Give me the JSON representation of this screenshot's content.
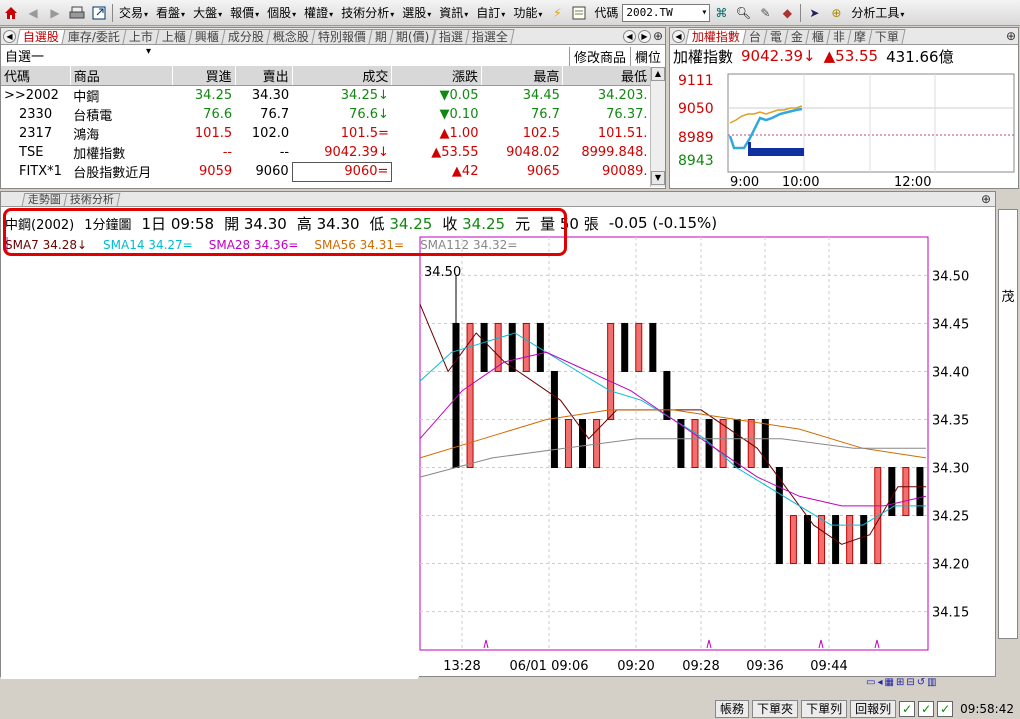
{
  "menubar": {
    "items": [
      "交易",
      "看盤",
      "大盤",
      "報價",
      "個股",
      "權證",
      "技術分析",
      "選股",
      "資訊",
      "自訂",
      "功能"
    ],
    "code_label": "代碼",
    "code_value": "2002.TW",
    "analysis_tools": "分析工具"
  },
  "watchlist": {
    "tabs": [
      "自選股",
      "庫存/委託",
      "上市",
      "上櫃",
      "興櫃",
      "成分股",
      "概念股",
      "特別報價",
      "期",
      "期(價)",
      "指選",
      "指選全"
    ],
    "list_name": "自選一",
    "edit_label": "修改商品",
    "field_label": "欄位",
    "headers": [
      "代碼",
      "商品",
      "買進",
      "賣出",
      "成交",
      "漲跌",
      "最高",
      "最低"
    ],
    "rows": [
      {
        "code": ">>2002",
        "name": "中鋼",
        "bid": "34.25",
        "ask": "34.30",
        "last": "34.25↓",
        "chg": "▼0.05",
        "high": "34.45",
        "low": "34.20",
        "extra": "3.",
        "color": "#118811",
        "chgcolor": "#118811"
      },
      {
        "code": "2330",
        "name": "台積電",
        "bid": "76.6",
        "ask": "76.7",
        "last": "76.6↓",
        "chg": "▼0.10",
        "high": "76.7",
        "low": "76.3",
        "extra": "7.",
        "color": "#118811",
        "chgcolor": "#118811"
      },
      {
        "code": "2317",
        "name": "鴻海",
        "bid": "101.5",
        "ask": "102.0",
        "last": "101.5=",
        "chg": "▲1.00",
        "high": "102.5",
        "low": "101.5",
        "extra": "1.",
        "color": "#d00000",
        "chgcolor": "#d00000"
      },
      {
        "code": "TSE",
        "name": "加權指數",
        "bid": "--",
        "ask": "--",
        "last": "9042.39↓",
        "chg": "▲53.55",
        "high": "9048.02",
        "low": "8999.84",
        "extra": "8.",
        "color": "#d00000",
        "chgcolor": "#d00000"
      },
      {
        "code": "FITX*1",
        "name": "台股指數近月",
        "bid": "9059",
        "ask": "9060",
        "last": "9060=",
        "chg": "▲42",
        "high": "9065",
        "low": "9008",
        "extra": "9.",
        "color": "#d00000",
        "chgcolor": "#d00000"
      }
    ]
  },
  "index_panel": {
    "tabs": [
      "加權指數",
      "台",
      "電",
      "金",
      "櫃",
      "非",
      "摩",
      "下單"
    ],
    "title": "加權指數",
    "value": "9042.39↓",
    "change": "▲53.55",
    "volume": "431.66億",
    "yticks": [
      "9111",
      "9050",
      "8989",
      "8943"
    ],
    "xticks": [
      "9:00",
      "10:00",
      "12:00"
    ]
  },
  "chart": {
    "tabs": [
      "走勢圖",
      "技術分析"
    ],
    "info": {
      "name": "中鋼(2002)",
      "period": "1分鐘圖",
      "date": "1日 09:58",
      "open_label": "開",
      "open": "34.30",
      "high_label": "高",
      "high": "34.30",
      "low_label": "低",
      "low": "34.25",
      "close_label": "收",
      "close": "34.25",
      "unit": "元",
      "vol_label": "量",
      "vol": "50",
      "vol_unit": "張",
      "change": "-0.05 (-0.15%)"
    },
    "sma": [
      "SMA7 34.28↓",
      "SMA14 34.27=",
      "SMA28 34.36=",
      "SMA56 34.31=",
      "SMA112 34.32="
    ],
    "peak_label": "34.50",
    "yticks": [
      "34.50",
      "34.45",
      "34.40",
      "34.35",
      "34.30",
      "34.25",
      "34.20",
      "34.15"
    ],
    "xticks": [
      "13:28",
      "06/01 09:06",
      "09:20",
      "09:28",
      "09:36",
      "09:44"
    ],
    "side_label": "茂"
  },
  "chart_data": {
    "type": "candlestick",
    "title": "",
    "ylim": [
      34.11,
      34.54
    ],
    "bar_values": [
      [
        34.45,
        34.5,
        34.3,
        34.3
      ],
      [
        34.3,
        34.45,
        34.3,
        34.45
      ],
      [
        34.45,
        34.45,
        34.4,
        34.4
      ],
      [
        34.4,
        34.45,
        34.4,
        34.45
      ],
      [
        34.45,
        34.45,
        34.4,
        34.4
      ],
      [
        34.4,
        34.45,
        34.4,
        34.45
      ],
      [
        34.45,
        34.45,
        34.4,
        34.4
      ],
      [
        34.4,
        34.4,
        34.3,
        34.3
      ],
      [
        34.3,
        34.35,
        34.3,
        34.35
      ],
      [
        34.35,
        34.35,
        34.3,
        34.3
      ],
      [
        34.3,
        34.35,
        34.3,
        34.35
      ],
      [
        34.35,
        34.45,
        34.35,
        34.45
      ],
      [
        34.45,
        34.45,
        34.4,
        34.4
      ],
      [
        34.4,
        34.45,
        34.4,
        34.45
      ],
      [
        34.45,
        34.45,
        34.4,
        34.4
      ],
      [
        34.4,
        34.4,
        34.35,
        34.35
      ],
      [
        34.35,
        34.35,
        34.3,
        34.3
      ],
      [
        34.3,
        34.35,
        34.3,
        34.35
      ],
      [
        34.35,
        34.35,
        34.3,
        34.3
      ],
      [
        34.3,
        34.35,
        34.3,
        34.35
      ],
      [
        34.35,
        34.35,
        34.3,
        34.3
      ],
      [
        34.3,
        34.35,
        34.3,
        34.35
      ],
      [
        34.35,
        34.35,
        34.3,
        34.3
      ],
      [
        34.3,
        34.3,
        34.2,
        34.2
      ],
      [
        34.2,
        34.25,
        34.2,
        34.25
      ],
      [
        34.25,
        34.25,
        34.2,
        34.2
      ],
      [
        34.2,
        34.25,
        34.2,
        34.25
      ],
      [
        34.25,
        34.25,
        34.2,
        34.2
      ],
      [
        34.2,
        34.25,
        34.2,
        34.25
      ],
      [
        34.25,
        34.25,
        34.2,
        34.2
      ],
      [
        34.2,
        34.3,
        34.2,
        34.3
      ],
      [
        34.3,
        34.3,
        34.25,
        34.25
      ],
      [
        34.25,
        34.3,
        34.25,
        34.3
      ],
      [
        34.3,
        34.3,
        34.25,
        34.25
      ]
    ],
    "sma_series": [
      {
        "name": "SMA7",
        "values": [
          34.47,
          34.4,
          34.44,
          34.41,
          34.39,
          34.37,
          34.33,
          34.36,
          34.36,
          34.36,
          34.36,
          34.34,
          34.32,
          34.28,
          34.24,
          34.22,
          34.23,
          34.28,
          34.28
        ]
      },
      {
        "name": "SMA14",
        "values": [
          34.39,
          34.42,
          34.43,
          34.44,
          34.42,
          34.4,
          34.38,
          34.37,
          34.35,
          34.33,
          34.3,
          34.28,
          34.26,
          34.24,
          34.24,
          34.26,
          34.26
        ]
      },
      {
        "name": "SMA28",
        "values": [
          34.33,
          34.38,
          34.41,
          34.42,
          34.4,
          34.38,
          34.35,
          34.32,
          34.29,
          34.27,
          34.26,
          34.26,
          34.27
        ]
      },
      {
        "name": "SMA56",
        "values": [
          34.31,
          34.33,
          34.35,
          34.36,
          34.36,
          34.35,
          34.34,
          34.32,
          34.31
        ]
      },
      {
        "name": "SMA112",
        "values": [
          34.29,
          34.31,
          34.32,
          34.33,
          34.33,
          34.33,
          34.32,
          34.32
        ]
      }
    ],
    "sma_colors": [
      "#6b0000",
      "#00bcd4",
      "#c000c0",
      "#d46a00",
      "#888888"
    ]
  },
  "status": {
    "buttons": [
      "帳務",
      "下單夾",
      "下單列",
      "回報列"
    ],
    "time": "09:58:42"
  }
}
